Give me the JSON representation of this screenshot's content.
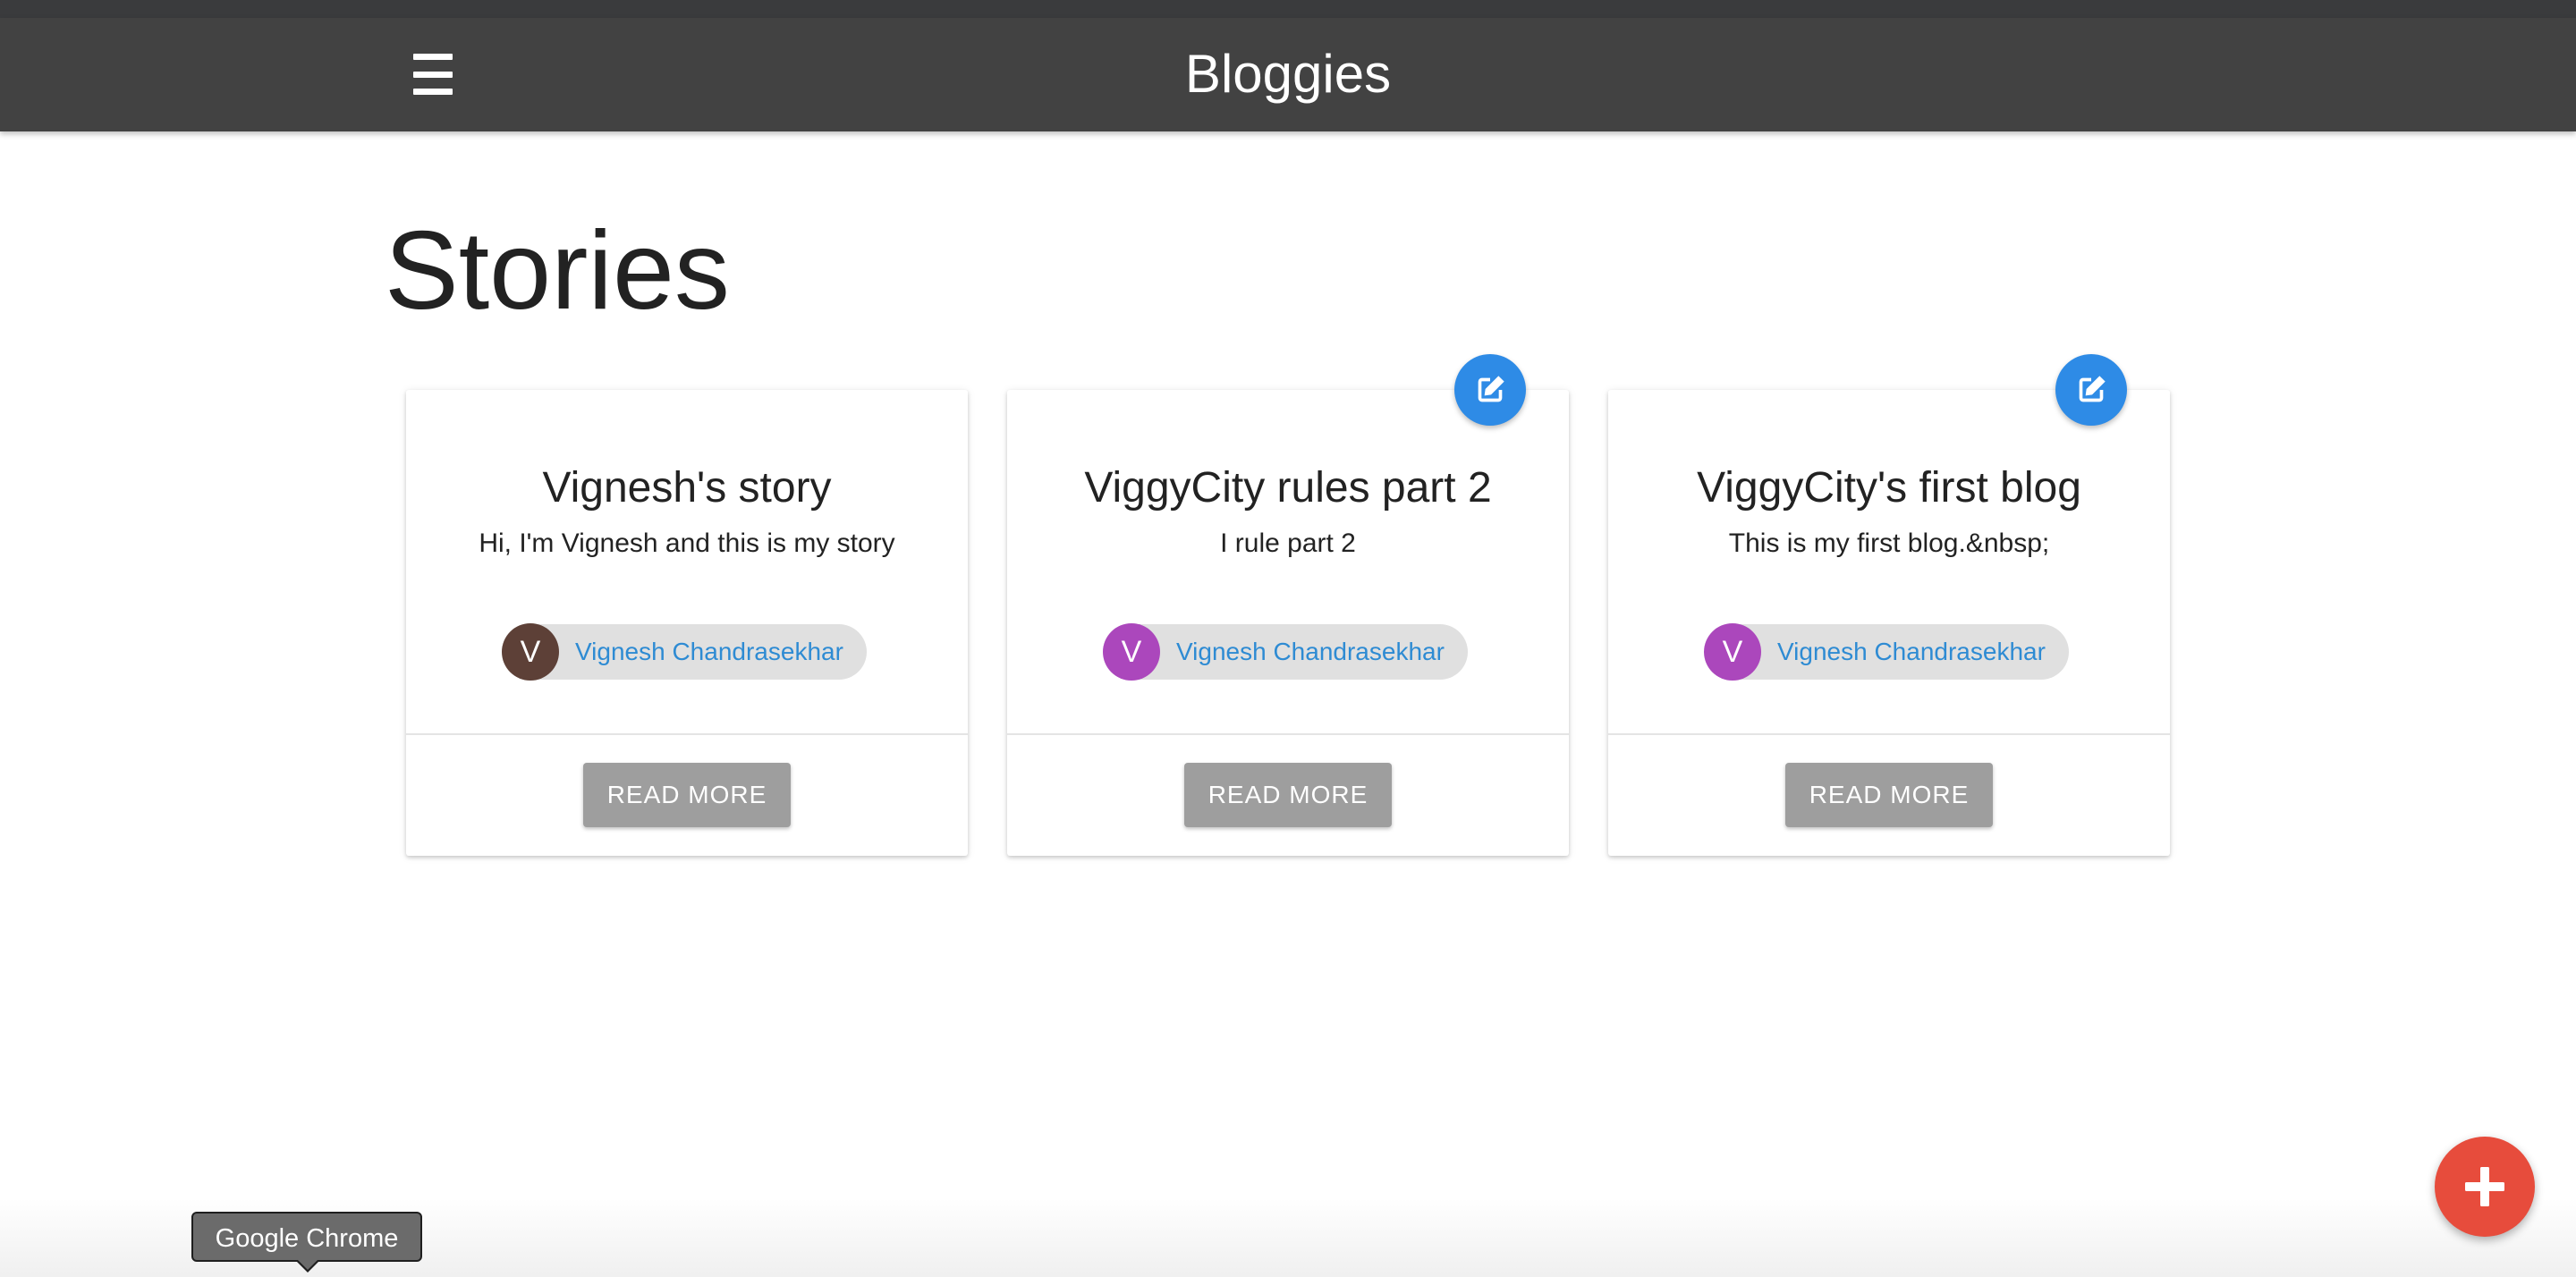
{
  "app": {
    "title": "Bloggies"
  },
  "page": {
    "title": "Stories"
  },
  "stories": [
    {
      "title": "Vignesh's story",
      "summary": "Hi, I'm Vignesh and this is my story",
      "author": "Vignesh Chandrasekhar",
      "avatar_letter": "V",
      "avatar_color": "#5d4037",
      "editable": false,
      "read_more_label": "READ MORE"
    },
    {
      "title": "ViggyCity rules part 2",
      "summary": "I rule part 2",
      "author": "Vignesh Chandrasekhar",
      "avatar_letter": "V",
      "avatar_color": "#ab47bc",
      "editable": true,
      "read_more_label": "READ MORE"
    },
    {
      "title": "ViggyCity's first blog",
      "summary": "This is my first blog.&nbsp;",
      "author": "Vignesh Chandrasekhar",
      "avatar_letter": "V",
      "avatar_color": "#ab47bc",
      "editable": true,
      "read_more_label": "READ MORE"
    }
  ],
  "tooltip": {
    "text": "Google Chrome"
  },
  "colors": {
    "app_bar": "#424242",
    "edit_fab": "#2e8be6",
    "add_fab": "#e74c3c",
    "author_link": "#2e8bd3",
    "read_more_button": "#9e9e9e"
  },
  "icons": {
    "menu": "hamburger-menu-icon",
    "edit": "edit-icon",
    "add": "plus-icon"
  }
}
